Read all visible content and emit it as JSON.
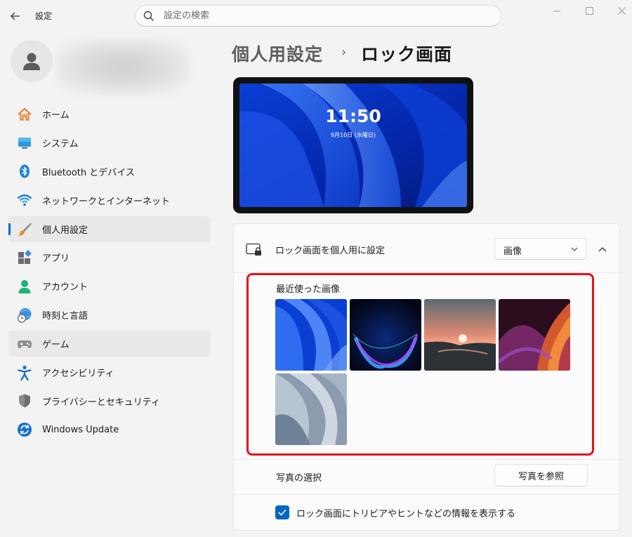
{
  "app": {
    "title": "設定"
  },
  "search": {
    "placeholder": "設定の検索"
  },
  "nav": {
    "items": [
      {
        "label": "ホーム",
        "icon": "home-icon"
      },
      {
        "label": "システム",
        "icon": "system-icon"
      },
      {
        "label": "Bluetooth とデバイス",
        "icon": "bluetooth-icon"
      },
      {
        "label": "ネットワークとインターネット",
        "icon": "network-icon"
      },
      {
        "label": "個人用設定",
        "icon": "brush-icon",
        "active": true
      },
      {
        "label": "アプリ",
        "icon": "apps-icon"
      },
      {
        "label": "アカウント",
        "icon": "account-icon"
      },
      {
        "label": "時刻と言語",
        "icon": "time-language-icon"
      },
      {
        "label": "ゲーム",
        "icon": "gamepad-icon"
      },
      {
        "label": "アクセシビリティ",
        "icon": "accessibility-icon"
      },
      {
        "label": "プライバシーとセキュリティ",
        "icon": "shield-icon"
      },
      {
        "label": "Windows Update",
        "icon": "update-icon"
      }
    ]
  },
  "header": {
    "breadcrumb_parent": "個人用設定",
    "breadcrumb_sep": "›",
    "title": "ロック画面"
  },
  "preview": {
    "time": "11:50",
    "date": "9月10日 (水曜日)"
  },
  "lock_screen": {
    "label": "ロック画面を個人用に設定",
    "dropdown_value": "画像",
    "recent_title": "最近使った画像",
    "photo_select_label": "写真の選択",
    "browse_button": "写真を参照",
    "show_info_label": "ロック画面にトリビアやヒントなどの情報を表示する",
    "show_info_checked": true
  },
  "colors": {
    "accent": "#0067c0",
    "highlight_border": "#e4141c"
  }
}
